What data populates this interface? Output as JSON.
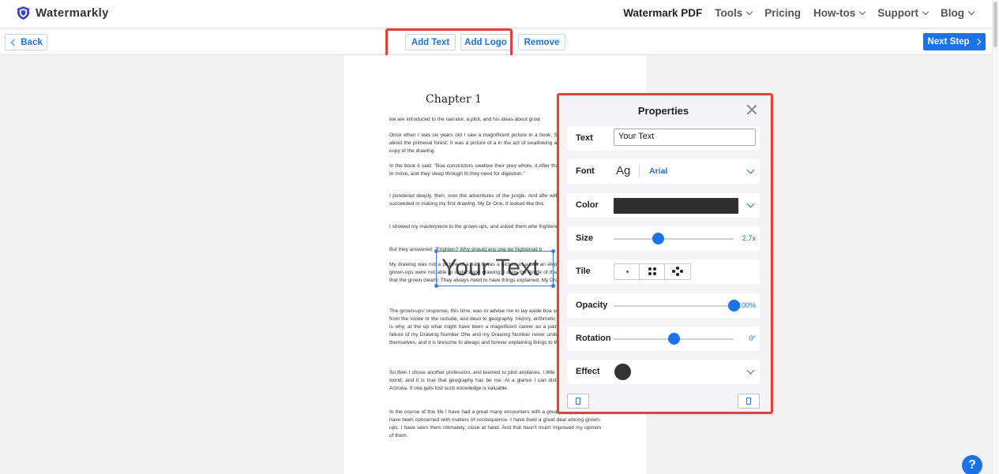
{
  "brand": {
    "name": "Watermarkly",
    "icon": "shield-icon",
    "color": "#3b46c4"
  },
  "nav": {
    "items": [
      {
        "label": "Watermark PDF",
        "dropdown": false
      },
      {
        "label": "Tools",
        "dropdown": true
      },
      {
        "label": "Pricing",
        "dropdown": false
      },
      {
        "label": "How-tos",
        "dropdown": true
      },
      {
        "label": "Support",
        "dropdown": true
      },
      {
        "label": "Blog",
        "dropdown": true
      }
    ]
  },
  "toolbar": {
    "back_label": "Back",
    "add_text_label": "Add Text",
    "add_logo_label": "Add Logo",
    "remove_label": "Remove",
    "next_label": "Next Step"
  },
  "document": {
    "chapter_title": "Chapter 1",
    "paragraphs": [
      "we are introduced to the narrator, a pilot, and his ideas about grow",
      "Once when I was six years old I saw a magnificent picture in a book, Stories from Nature, about the primeval forest. It was a picture of a in the act of swallowing an animal. Here is a copy of the drawing.",
      "In the book it said: \"Boa constrictors swallow their prey whole, it.After that they are not able to move, and they sleep through th they need for digestion.\"",
      "I pondered deeply, then, over the adventures of the jungle. And afte with a colored pencil I succeeded in making my first drawing. My Dr One. It looked like this:",
      "I showed my masterpiece to the grown-ups, and asked them whe frightened them.",
      "But they answered: \"Frighten? Why should any one be frightened b",
      "My drawing was not a picture of a hat. It was a picture of a boa an elephant. But since the grown-ups were not able to understand drawing: I drew the inside of the boa constrictor, so that the grown clearly. They always need to have things explained. My Drawing Nu like this:",
      "The grown-ups' response, this time, was to advise me to lay aside boa constrictors, whether from the inside or the outside, and devo to geography, history, arithmetic and grammar. That is why, at the up what might have been a magnificent career as a painter. I had b by the failure of my Drawing Number One and my Drawing Number never understand anything by themselves, and it is tiresome fo always and forever explaining things to them.",
      "So then I chose another profession, and learned to pilot airplanes. I little over all parts of the world; and it is true that geography has be me. At a glance I can distinguish China from Arizona. If one gets lost such knowledge is valuable.",
      "In the course of this life I have had a great many encounters with a great many people who have been concerned with matters of consequence. I have lived a great deal among grown-ups. I have seen them intimately, close at hand. And that hasn't much improved my opinion of them."
    ],
    "watermark_text": "Your Text"
  },
  "properties": {
    "title": "Properties",
    "text_label": "Text",
    "text_value": "Your Text",
    "font_label": "Font",
    "font_sample": "Ag",
    "font_value": "Arial",
    "color_label": "Color",
    "color_value": "#2e2e2e",
    "size_label": "Size",
    "size_value": "2.7x",
    "size_fraction": 0.37,
    "tile_label": "Tile",
    "tile_options": [
      "single",
      "four-grid",
      "diamond"
    ],
    "tile_selected": "single",
    "opacity_label": "Opacity",
    "opacity_value": "100%",
    "opacity_fraction": 1.0,
    "rotation_label": "Rotation",
    "rotation_value": "0°",
    "rotation_fraction": 0.5,
    "effect_label": "Effect"
  },
  "colors": {
    "accent": "#1a73e8",
    "highlight": "#e04436"
  }
}
